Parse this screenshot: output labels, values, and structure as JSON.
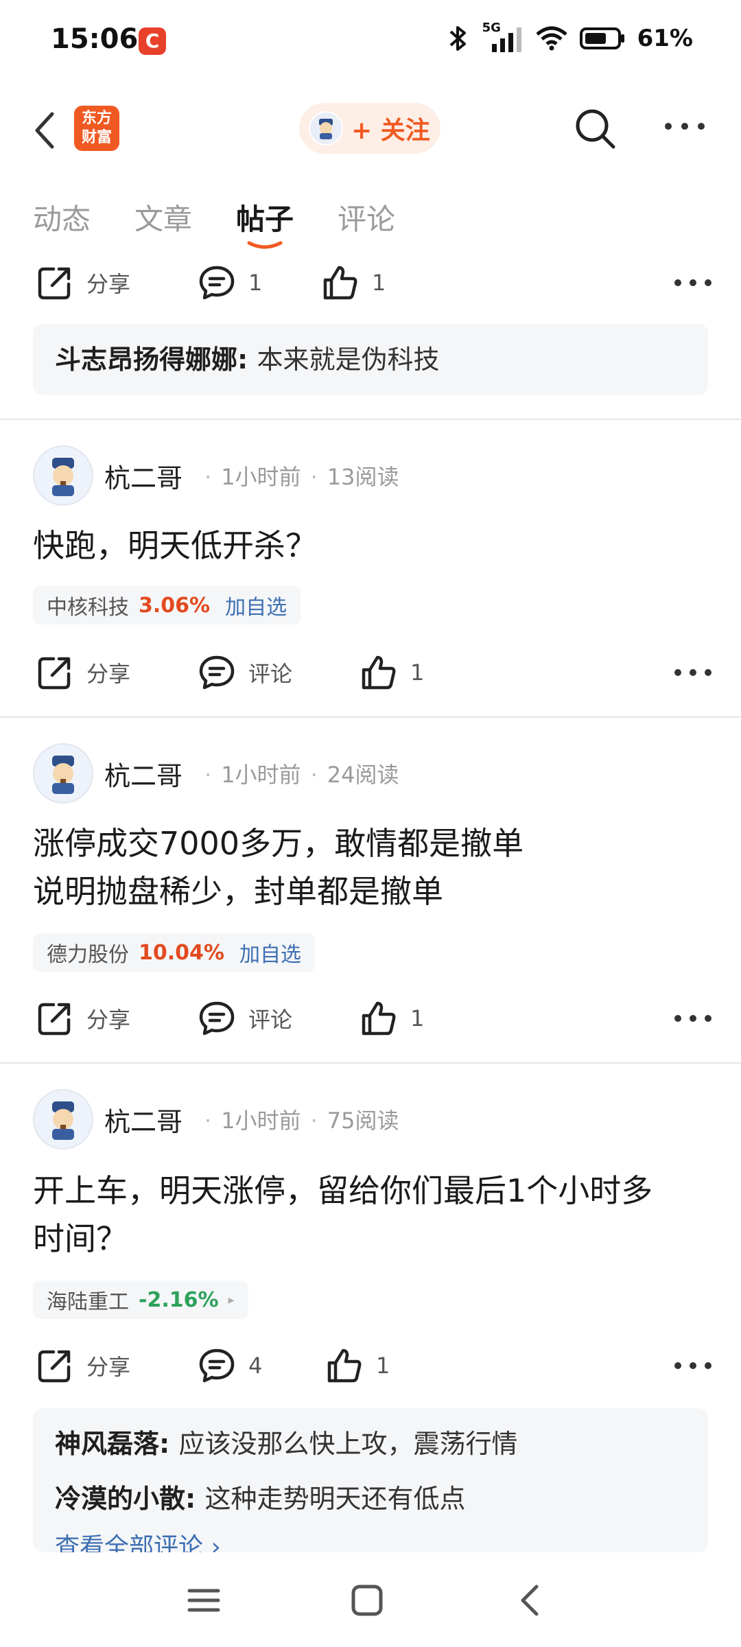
{
  "status_bar": {
    "time": "15:06",
    "app_icon_letter": "C",
    "network": "5G",
    "battery": "61%"
  },
  "header": {
    "logo_line1": "东方",
    "logo_line2": "财富",
    "follow_label": "+ 关注",
    "icons": [
      "back-icon",
      "search-icon",
      "more-icon"
    ]
  },
  "tabs": [
    {
      "label": "动态",
      "active": false
    },
    {
      "label": "文章",
      "active": false
    },
    {
      "label": "帖子",
      "active": true
    },
    {
      "label": "评论",
      "active": false
    }
  ],
  "top_actions": {
    "share": "分享",
    "comments": "1",
    "likes": "1"
  },
  "top_comment": {
    "user": "斗志昂扬得娜娜",
    "text": "本来就是伪科技"
  },
  "posts": [
    {
      "author": "杭二哥",
      "time": "1小时前",
      "reads": "13阅读",
      "text_lines": [
        "快跑，明天低开杀？"
      ],
      "stock": {
        "name": "中核科技",
        "change": "3.06%",
        "action": "加自选"
      },
      "actions": {
        "share": "分享",
        "comment": "评论",
        "likes": "1"
      }
    },
    {
      "author": "杭二哥",
      "time": "1小时前",
      "reads": "24阅读",
      "text_lines": [
        "涨停成交7000多万，敢情都是撤单",
        "说明抛盘稀少，封单都是撤单"
      ],
      "stock": {
        "name": "德力股份",
        "change": "10.04%",
        "action": "加自选"
      },
      "actions": {
        "share": "分享",
        "comment": "评论",
        "likes": "1"
      }
    },
    {
      "author": "杭二哥",
      "time": "1小时前",
      "reads": "75阅读",
      "text_lines": [
        "开上车，明天涨停，留给你们最后1个小时多",
        "时间？"
      ],
      "stock": {
        "name": "海陆重工",
        "change": "-2.16%",
        "action": "▸"
      },
      "actions": {
        "share": "分享",
        "comment": "4",
        "likes": "1"
      },
      "comments": [
        {
          "user": "神风磊落",
          "text": "应该没那么快上攻，震荡行情"
        },
        {
          "user": "冷漠的小散",
          "text": "这种走势明天还有低点"
        }
      ],
      "view_all": "查看全部评论 ›"
    }
  ],
  "colors": {
    "brand": "#f05a22",
    "up": "#e24a1f",
    "down": "#2da15a",
    "link": "#3d6fb2"
  }
}
